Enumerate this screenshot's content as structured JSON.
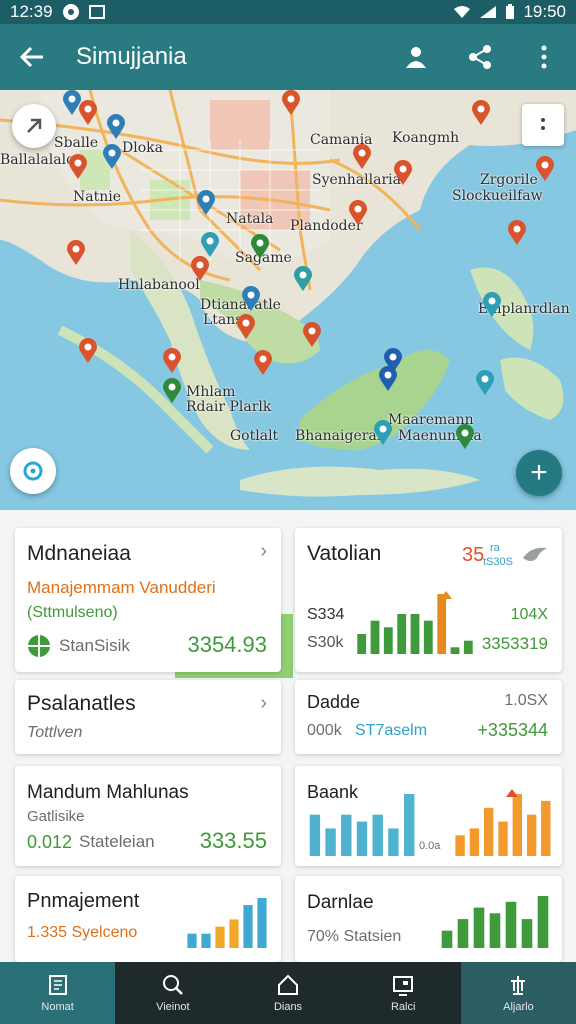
{
  "status_bar": {
    "time_left": "12:39",
    "time_right": "19:50"
  },
  "app_bar": {
    "title": "Simujjania"
  },
  "map": {
    "labels": [
      "Sballe",
      "Dloka",
      "Ballalalalo",
      "Camania",
      "Koangmh",
      "Syenhallaria",
      "Natnie",
      "Zrgorile",
      "Slockueilfaw",
      "Natala",
      "Plandoder",
      "Sagame",
      "Hnlabanool",
      "Dtianasatle",
      "Ltansi",
      "Emplanrdlan",
      "Mhlam",
      "Rdair Plarlk",
      "Maaremann",
      "Gotlalt",
      "Bhanaigeran",
      "Maenuniala"
    ]
  },
  "cards": {
    "c1": {
      "title": "Mdnaneiaa",
      "line1": "Manajemmam Vanudderi",
      "line2": "(Sttmulseno)",
      "label": "StanSisik",
      "value": "3354.93"
    },
    "c2": {
      "title": "Vatolian",
      "badge_num": "35",
      "badge_sub": "ra",
      "badge_small": "tS30S",
      "left_top": "S334",
      "left_bottom": "S30k",
      "right_top": "104X",
      "right_bottom": "3353319"
    },
    "c3": {
      "title": "Psalanatles",
      "subtitle": "Tottlven"
    },
    "c4": {
      "title": "Dadde",
      "left": "000k",
      "blue": "ST7aselm",
      "right_top": "1.0SX",
      "right": "+335344"
    },
    "c5": {
      "title": "Mandum Mahlunas",
      "subtitle": "Gatlisike",
      "left": "0.012",
      "label": "Stateleian",
      "value": "333.55"
    },
    "c6": {
      "title": "Baank",
      "tick": "0.0a"
    },
    "c7": {
      "title": "Pnmajement",
      "left": "1.335 Syelceno"
    },
    "c8": {
      "title": "Darnlae",
      "left": "70% Statsien"
    }
  },
  "chart_data": [
    {
      "type": "bar",
      "name": "vatolian-bars",
      "values": [
        3,
        5,
        4,
        6,
        6,
        5,
        9,
        1,
        2
      ],
      "colors": [
        "#3e9a3a",
        "#3e9a3a",
        "#3e9a3a",
        "#3e9a3a",
        "#3e9a3a",
        "#3e9a3a",
        "#e68a1f",
        "#3e9a3a",
        "#3e9a3a"
      ]
    },
    {
      "type": "bar",
      "name": "baank-left-bars",
      "values": [
        6,
        4,
        6,
        5,
        6,
        4,
        9
      ],
      "colors": [
        "#4fb3cf",
        "#4fb3cf",
        "#4fb3cf",
        "#4fb3cf",
        "#4fb3cf",
        "#4fb3cf",
        "#4fb3cf"
      ]
    },
    {
      "type": "bar",
      "name": "baank-right-bars",
      "values": [
        3,
        4,
        7,
        5,
        9,
        6,
        8
      ],
      "colors": [
        "#f29a2e",
        "#f29a2e",
        "#f29a2e",
        "#f29a2e",
        "#f29a2e",
        "#f29a2e",
        "#f29a2e"
      ]
    },
    {
      "type": "bar",
      "name": "pnmajement-bars",
      "values": [
        2,
        2,
        3,
        4,
        6,
        7
      ],
      "colors": [
        "#3fa9d2",
        "#3fa9d2",
        "#f1a72a",
        "#f1a72a",
        "#3fa9d2",
        "#3fa9d2"
      ]
    },
    {
      "type": "bar",
      "name": "darnlae-bars",
      "values": [
        3,
        5,
        7,
        6,
        8,
        5,
        9
      ],
      "colors": [
        "#3e9a3a",
        "#3e9a3a",
        "#3e9a3a",
        "#3e9a3a",
        "#3e9a3a",
        "#3e9a3a",
        "#3e9a3a"
      ]
    }
  ],
  "bottom_nav": [
    {
      "label": "Nomat",
      "icon": "document-icon"
    },
    {
      "label": "Vieinot",
      "icon": "search-icon"
    },
    {
      "label": "Dians",
      "icon": "home-icon"
    },
    {
      "label": "Ralci",
      "icon": "tablet-icon"
    },
    {
      "label": "Aljarlo",
      "icon": "tune-icon"
    }
  ]
}
